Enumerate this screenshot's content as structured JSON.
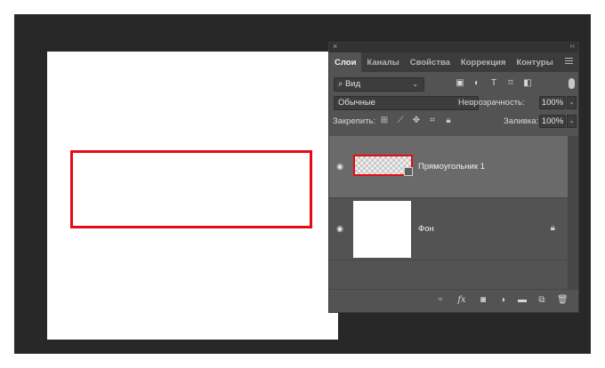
{
  "panel": {
    "tabs": [
      "Слои",
      "Каналы",
      "Свойства",
      "Коррекция",
      "Контуры"
    ],
    "active_tab": "Слои",
    "filter": {
      "value": "Вид"
    },
    "blend_mode": "Обычные",
    "opacity_label": "Непрозрачность:",
    "opacity_value": "100%",
    "lock_label": "Закрепить:",
    "fill_label": "Заливка:",
    "fill_value": "100%"
  },
  "layers": [
    {
      "name": "Прямоугольник 1",
      "selected": true,
      "visible": true
    },
    {
      "name": "Фон",
      "selected": false,
      "visible": true,
      "locked": true
    }
  ],
  "colors": {
    "workspace": "#282828",
    "panel": "#535353",
    "shape_stroke": "#e60b13",
    "selected_layer": "#6a6a6a"
  },
  "icons": {
    "filter_icons": [
      "image-filter-icon",
      "adjustment-filter-icon",
      "type-filter-icon",
      "shape-filter-icon",
      "smart-object-filter-icon"
    ],
    "lock_icons": [
      "lock-transparent-icon",
      "lock-brush-icon",
      "lock-move-icon",
      "lock-artboard-icon",
      "lock-all-icon"
    ],
    "bottom_icons": [
      "link-icon",
      "fx-icon",
      "mask-icon",
      "adjustment-layer-icon",
      "group-folder-icon",
      "new-layer-icon",
      "trash-icon"
    ]
  }
}
